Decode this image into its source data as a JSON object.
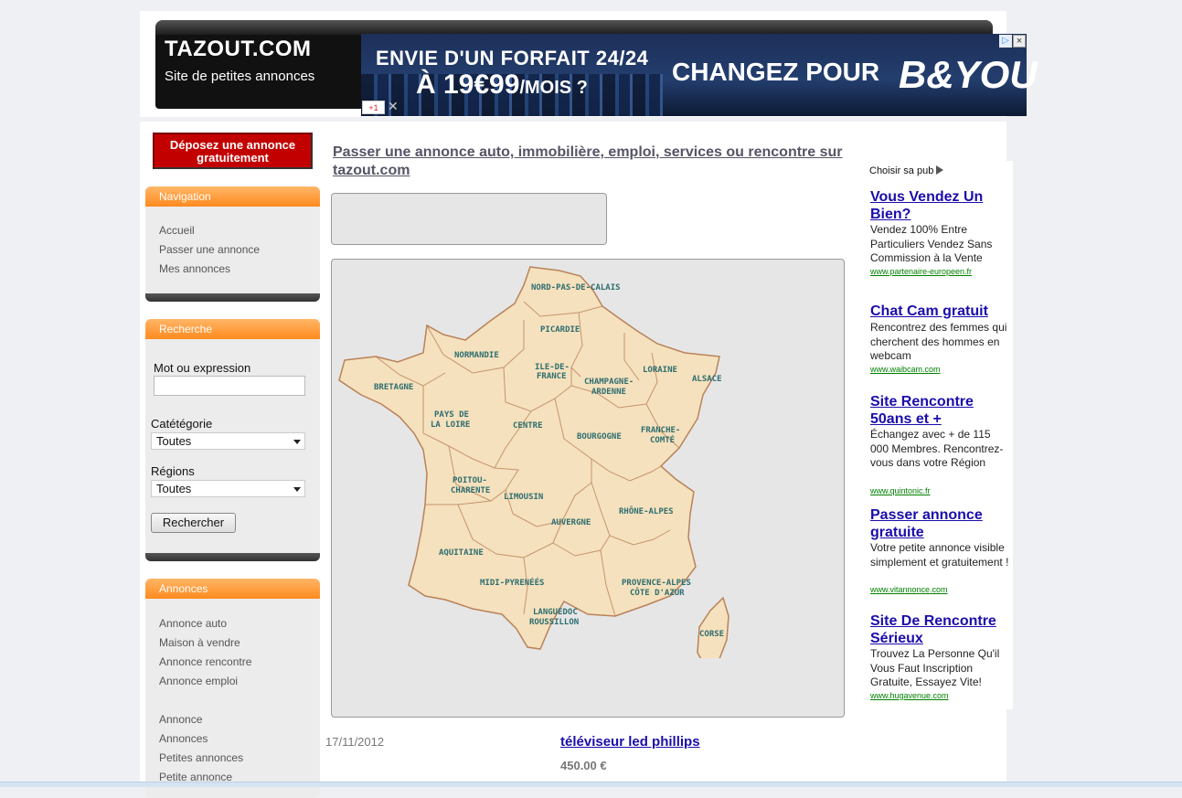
{
  "header": {
    "site_name": "TAZOUT.COM",
    "tagline": "Site de petites annonces"
  },
  "banner": {
    "line1": "ENVIE D'UN FORFAIT 24/24",
    "line2_prefix": "À 19€99",
    "line2_suffix": "/MOIS ?",
    "cta": "CHANGEZ POUR",
    "brand": "B&YOU",
    "gplus": "+1",
    "close": "×"
  },
  "sidebar": {
    "post_ad_button": "Déposez une annonce gratuitement",
    "nav_title": "Navigation",
    "nav_items": [
      "Accueil",
      "Passer une annonce",
      "Mes annonces"
    ],
    "search_title": "Recherche",
    "keyword_label": "Mot ou expression",
    "keyword_value": "",
    "category_label": "Catétégorie",
    "category_value": "Toutes",
    "regions_label": "Régions",
    "regions_value": "Toutes",
    "search_button": "Rechercher",
    "ads_title": "Annonces",
    "ads_items": [
      "Annonce auto",
      "Maison à vendre",
      "Annonce rencontre",
      "Annonce emploi"
    ],
    "ads_items2": [
      "Annonce",
      "Annonces",
      "Petites annonces",
      "Petite annonce"
    ]
  },
  "main": {
    "heading": "Passer une annonce auto, immobilière, emploi, services ou rencontre sur tazout.com",
    "regions": [
      "NORD-PAS-DE-CALAIS",
      "PICARDIE",
      "NORMANDIE",
      "ILE-DE-",
      "FRANCE",
      "CHAMPAGNE-",
      "ARDENNE",
      "LORAINE",
      "ALSACE",
      "BRETAGNE",
      "PAYS DE",
      "LA LOIRE",
      "CENTRE",
      "BOURGOGNE",
      "FRANCHE-",
      "COMTÉ",
      "POITOU-",
      "CHARENTE",
      "LIMOUSIN",
      "AUVERGNE",
      "RHÔNE-ALPES",
      "AQUITAINE",
      "MIDI-PYRENÉÉS",
      "PROVENCE-ALPES",
      "CÔTE D'AZUR",
      "LANGUEDOC",
      "ROUSSILLON",
      "CORSE"
    ],
    "listing": {
      "date": "17/11/2012",
      "title": "téléviseur led phillips",
      "price": "450.00 €"
    }
  },
  "ads": {
    "choice_label": "Choisir sa pub",
    "items": [
      {
        "title": "Vous Vendez Un Bien?",
        "body": "Vendez 100% Entre Particuliers Vendez Sans Commission à la Vente",
        "url": "www.partenaire-europeen.fr"
      },
      {
        "title": "Chat Cam gratuit",
        "body": "Rencontrez des femmes qui cherchent des hommes en webcam",
        "url": "www.waibcam.com"
      },
      {
        "title": "Site Rencontre 50ans et +",
        "body": "Échangez avec + de 115 000 Membres. Rencontrez-vous dans votre Région",
        "url": "www.quintonic.fr"
      },
      {
        "title": "Passer annonce gratuite",
        "body": "Votre petite annonce visible simplement et gratuitement !",
        "url": "www.vitannonce.com"
      },
      {
        "title": "Site De Rencontre Sérieux",
        "body": "Trouvez La Personne Qu'il Vous Faut Inscription Gratuite, Essayez Vite!",
        "url": "www.hugavenue.com"
      }
    ]
  }
}
